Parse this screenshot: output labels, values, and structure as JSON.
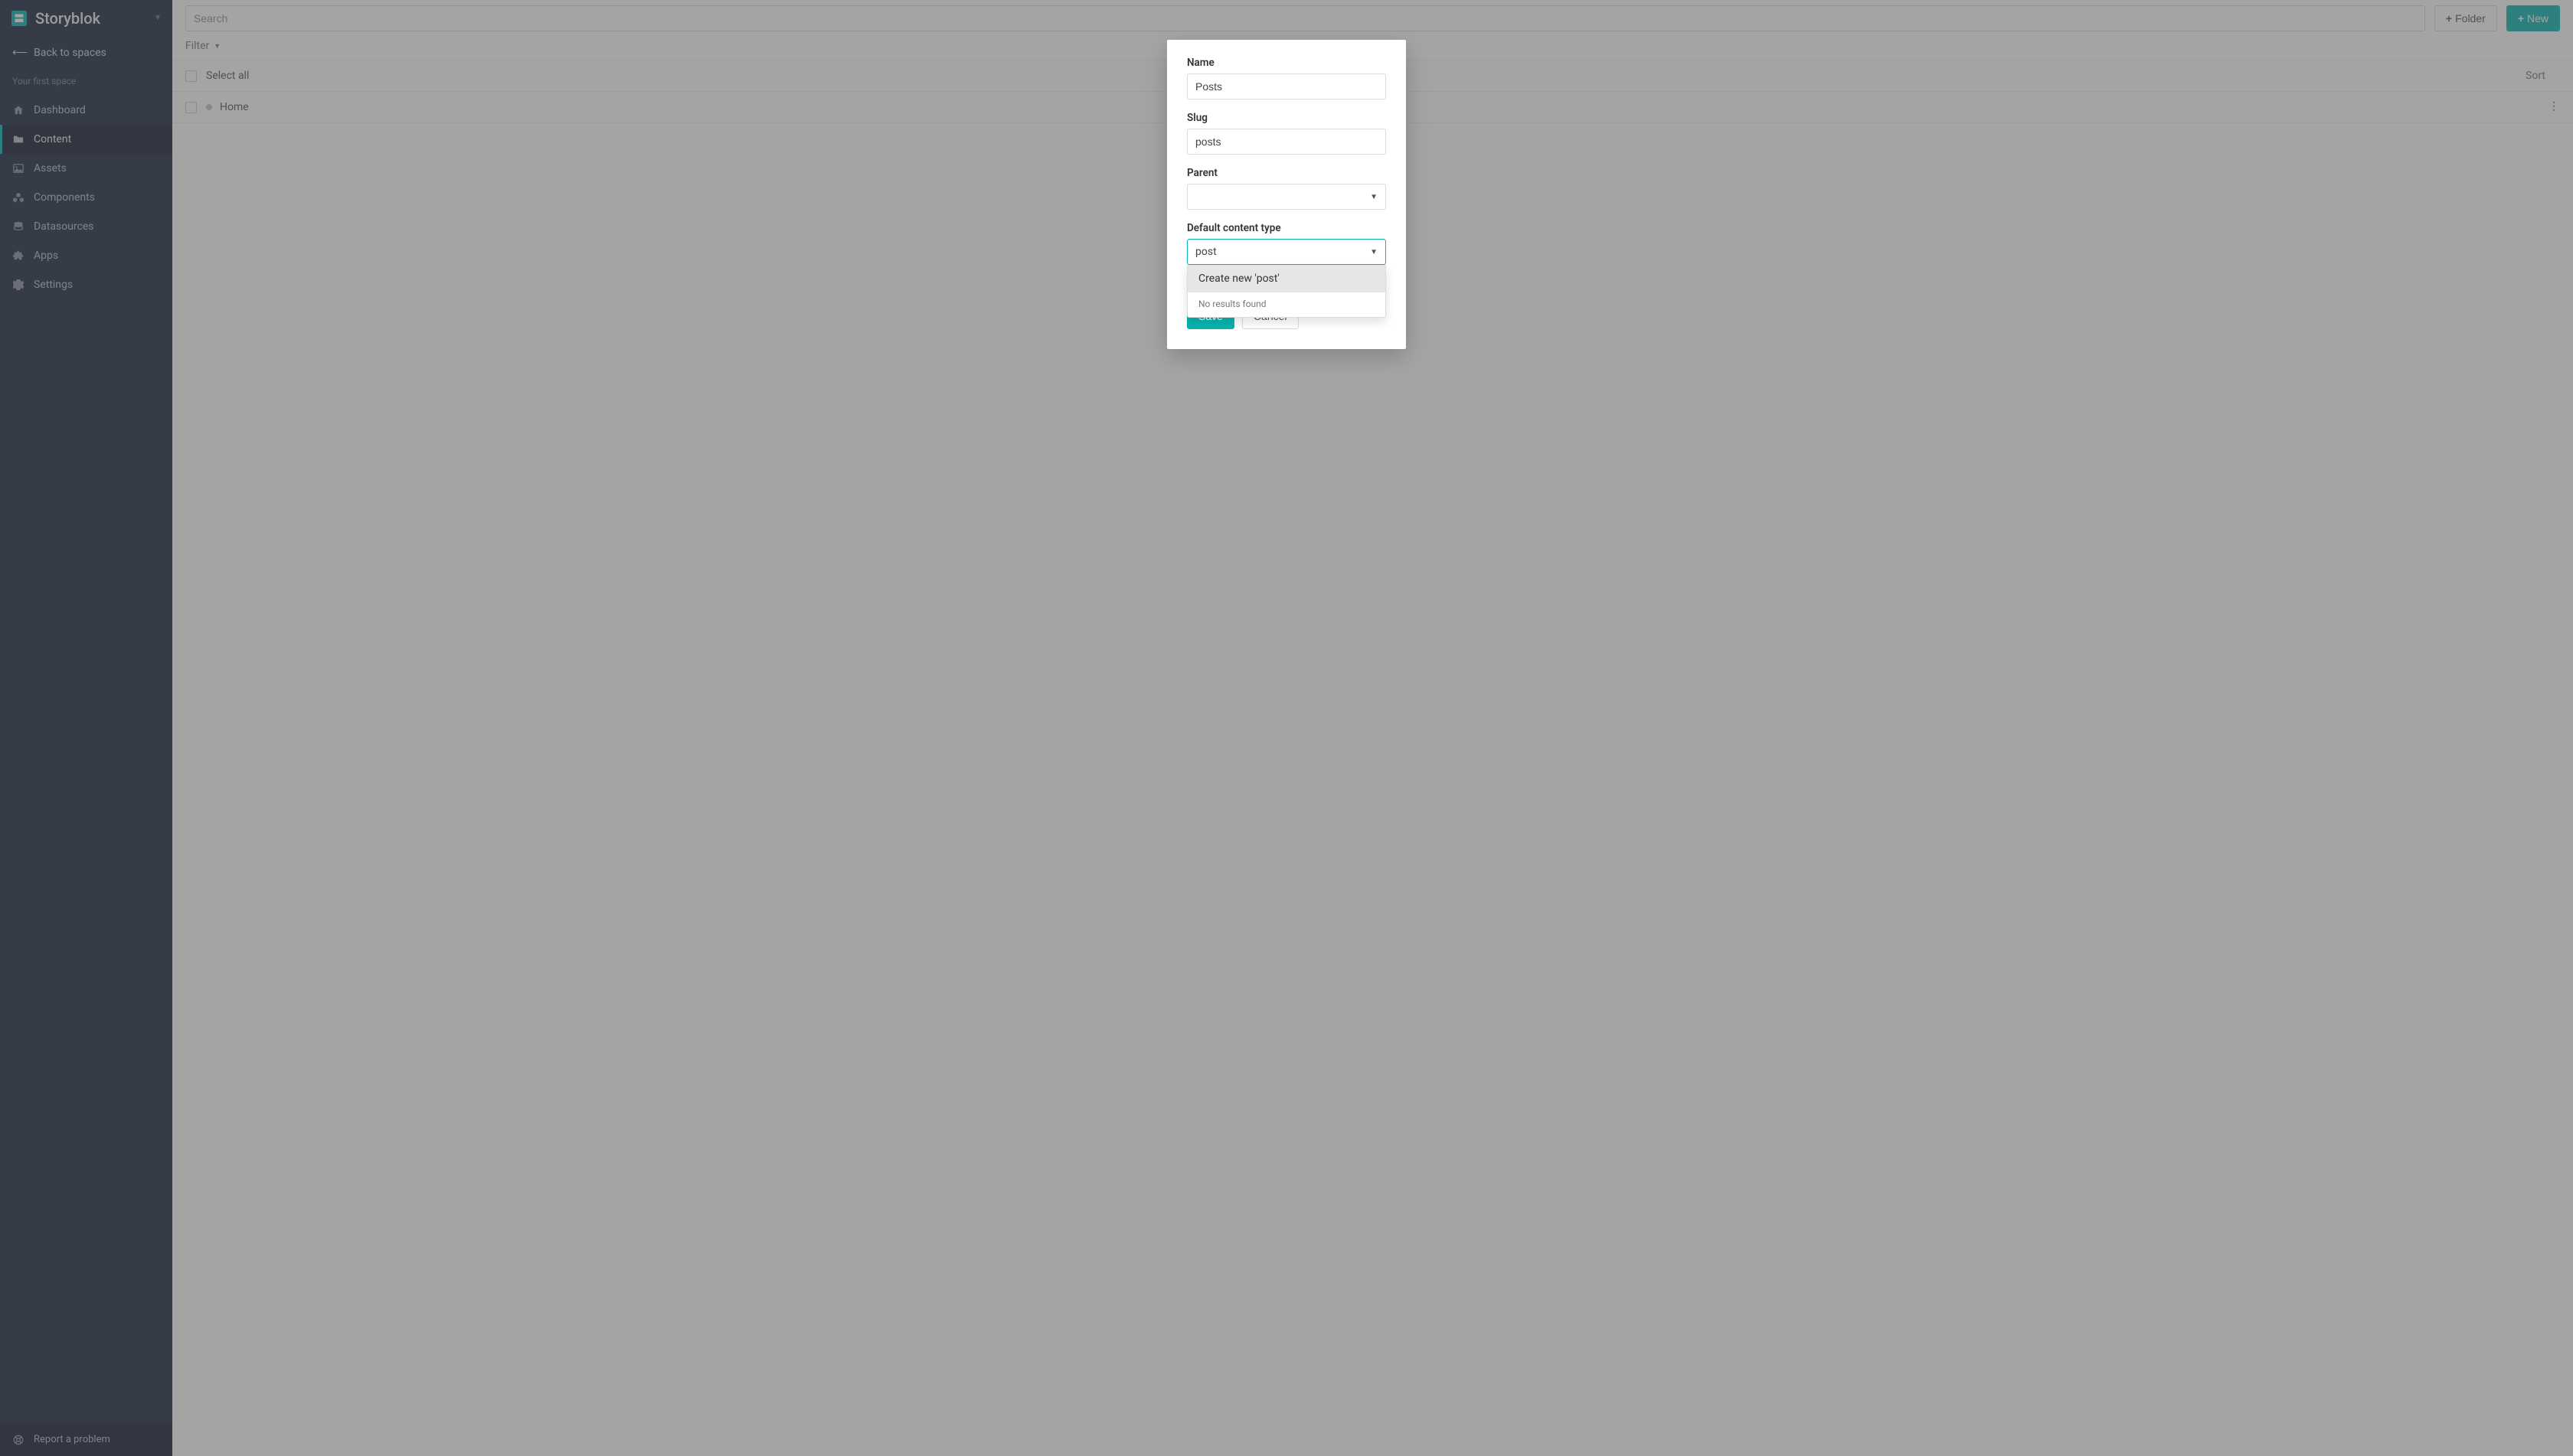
{
  "brand": {
    "name": "Storyblok"
  },
  "back_to_spaces": "Back to spaces",
  "space_name": "Your first space",
  "nav": {
    "items": [
      {
        "label": "Dashboard"
      },
      {
        "label": "Content"
      },
      {
        "label": "Assets"
      },
      {
        "label": "Components"
      },
      {
        "label": "Datasources"
      },
      {
        "label": "Apps"
      },
      {
        "label": "Settings"
      }
    ],
    "active_index": 1
  },
  "footer": {
    "report_problem": "Report a problem"
  },
  "topbar": {
    "search_placeholder": "Search",
    "folder_button": "Folder",
    "new_button": "New"
  },
  "filter": {
    "label": "Filter"
  },
  "list": {
    "select_all": "Select all",
    "sort": "Sort",
    "rows": [
      {
        "title": "Home"
      }
    ]
  },
  "modal": {
    "fields": {
      "name": {
        "label": "Name",
        "value": "Posts"
      },
      "slug": {
        "label": "Slug",
        "value": "posts"
      },
      "parent": {
        "label": "Parent",
        "value": ""
      },
      "default_content_type": {
        "label": "Default content type",
        "value": "post",
        "dropdown": {
          "create_new": "Create new 'post'",
          "no_results": "No results found"
        }
      }
    },
    "buttons": {
      "save": "Save",
      "cancel": "Cancel"
    }
  }
}
